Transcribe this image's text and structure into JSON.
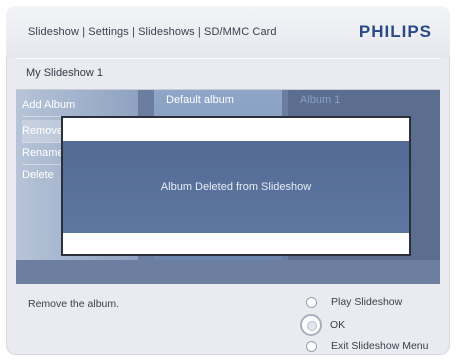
{
  "header": {
    "breadcrumb": "Slideshow | Settings | Slideshows | SD/MMC Card",
    "brand": "PHILIPS"
  },
  "page": {
    "title": "My Slideshow 1"
  },
  "menu": {
    "items": [
      {
        "label": "Add Album"
      },
      {
        "label": "Remove"
      },
      {
        "label": "Rename"
      },
      {
        "label": "Delete"
      }
    ]
  },
  "albums": [
    {
      "label": "Default album"
    },
    {
      "label": "Album 1"
    }
  ],
  "dialog": {
    "message": "Album Deleted from Slideshow"
  },
  "footer": {
    "hint": "Remove the album.",
    "options": [
      {
        "label": "Play Slideshow"
      },
      {
        "label": "OK"
      },
      {
        "label": "Exit Slideshow Menu"
      }
    ]
  }
}
